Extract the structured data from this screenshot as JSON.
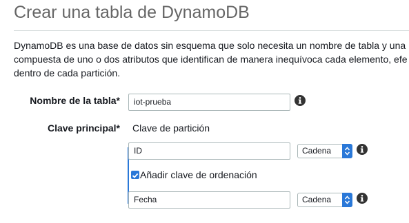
{
  "page": {
    "title": "Crear una tabla de DynamoDB",
    "description_lines": [
      "DynamoDB es una base de datos sin esquema que solo necesita un nombre de tabla y una",
      "compuesta de uno o dos atributos que identifican de manera inequívoca cada elemento, efe",
      "dentro de cada partición."
    ]
  },
  "form": {
    "table_name_label": "Nombre de la tabla*",
    "table_name_value": "iot-prueba",
    "primary_key_label": "Clave principal*",
    "partition_key_caption": "Clave de partición",
    "partition_key_value": "ID",
    "partition_key_type": "Cadena",
    "add_sort_key_label": "Añadir clave de ordenación",
    "add_sort_key_checked": true,
    "sort_key_value": "Fecha",
    "sort_key_type": "Cadena"
  },
  "icons": {
    "info": "info-icon",
    "select_arrows": "up-down-arrows-icon",
    "checkmark": "checkmark-icon"
  },
  "colors": {
    "accent": "#2a78d8",
    "title": "#666666",
    "border": "#aab7b8"
  }
}
